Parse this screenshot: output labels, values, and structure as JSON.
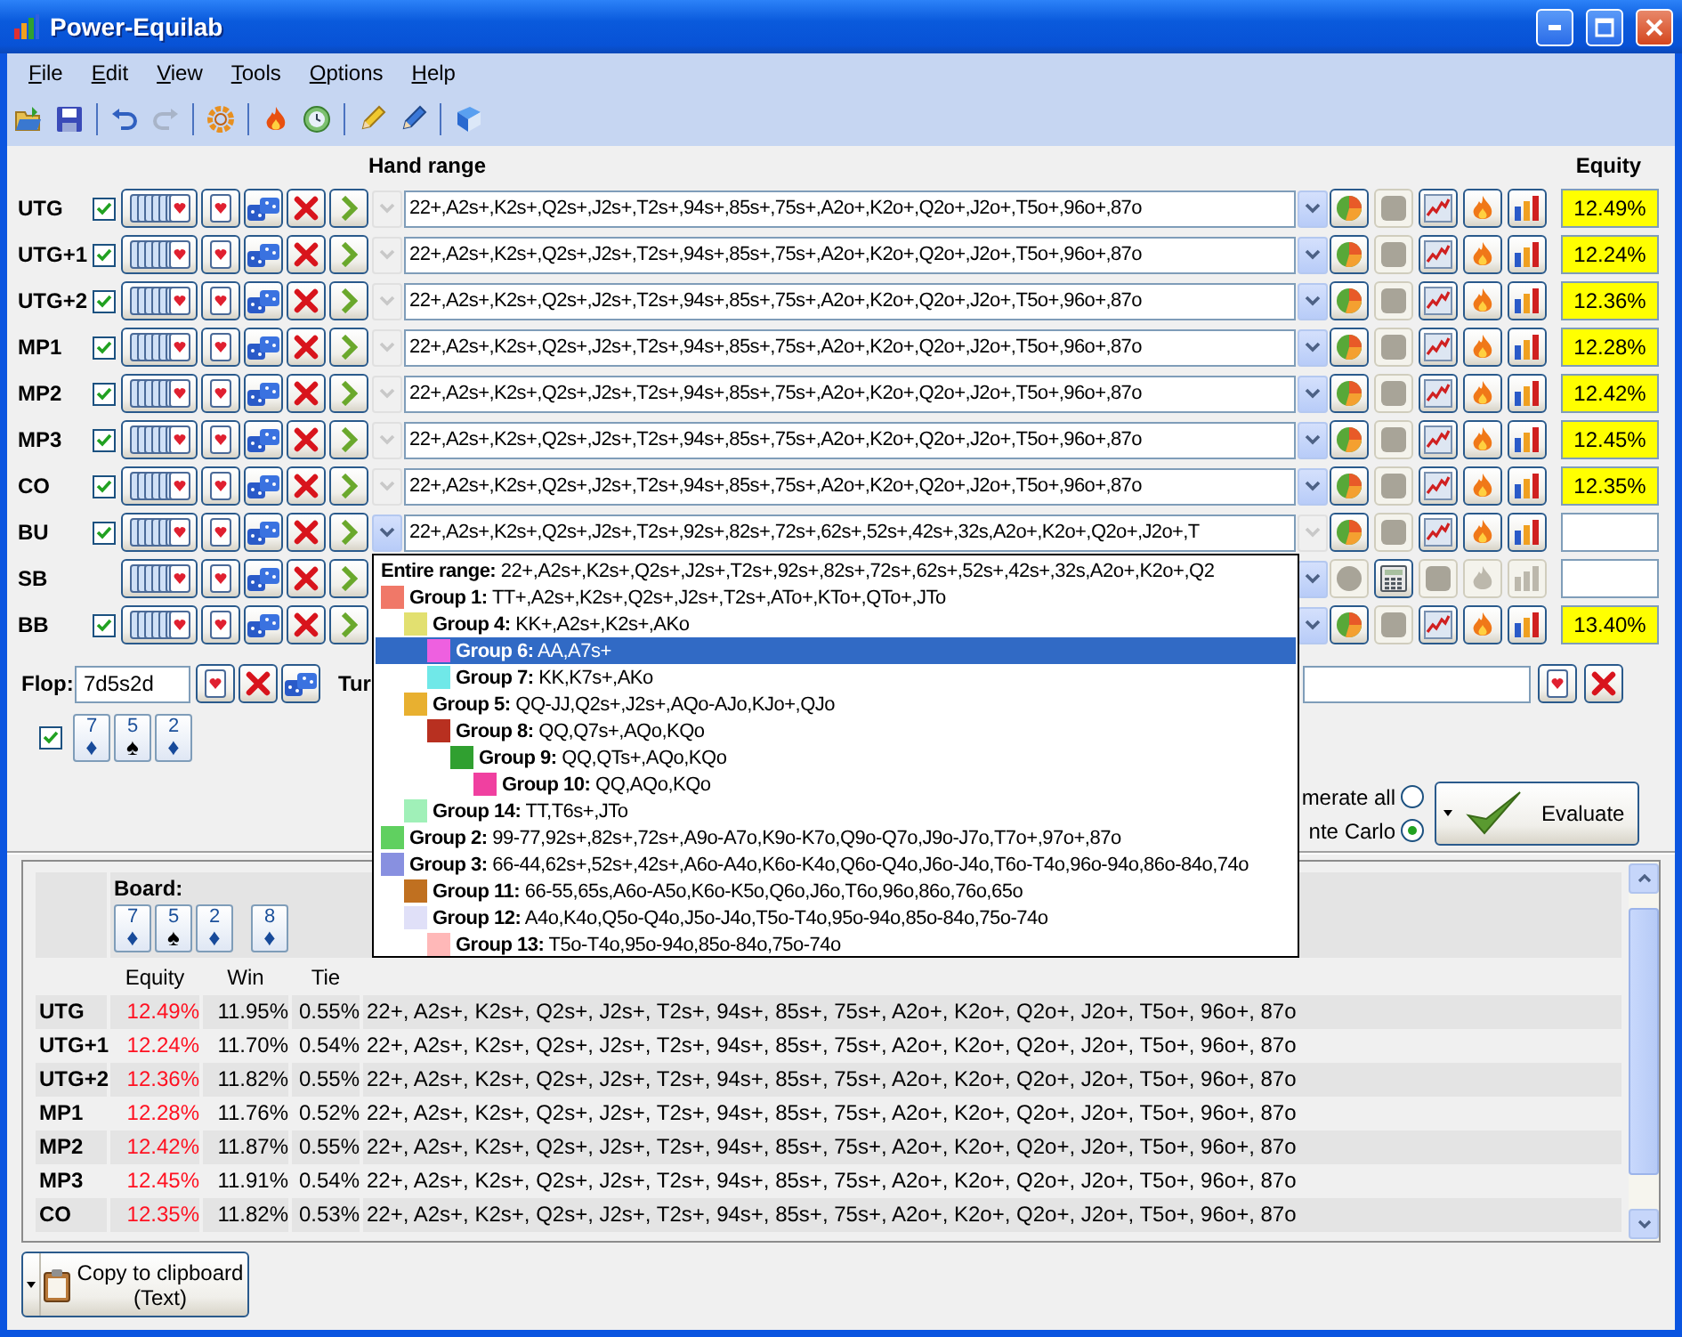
{
  "window": {
    "title": "Power-Equilab"
  },
  "menu": [
    "File",
    "Edit",
    "View",
    "Tools",
    "Options",
    "Help"
  ],
  "toolbar": {
    "redo_disabled": true
  },
  "headers": {
    "range": "Hand range",
    "equity": "Equity"
  },
  "players": [
    {
      "name": "UTG",
      "checked": true,
      "kind": "range",
      "editing": false,
      "range": "22+,A2s+,K2s+,Q2s+,J2s+,T2s+,94s+,85s+,75s+,A2o+,K2o+,Q2o+,J2o+,T5o+,96o+,87o",
      "equity": "12.49%"
    },
    {
      "name": "UTG+1",
      "checked": true,
      "kind": "range",
      "editing": false,
      "range": "22+,A2s+,K2s+,Q2s+,J2s+,T2s+,94s+,85s+,75s+,A2o+,K2o+,Q2o+,J2o+,T5o+,96o+,87o",
      "equity": "12.24%"
    },
    {
      "name": "UTG+2",
      "checked": true,
      "kind": "range",
      "editing": false,
      "range": "22+,A2s+,K2s+,Q2s+,J2s+,T2s+,94s+,85s+,75s+,A2o+,K2o+,Q2o+,J2o+,T5o+,96o+,87o",
      "equity": "12.36%"
    },
    {
      "name": "MP1",
      "checked": true,
      "kind": "range",
      "editing": false,
      "range": "22+,A2s+,K2s+,Q2s+,J2s+,T2s+,94s+,85s+,75s+,A2o+,K2o+,Q2o+,J2o+,T5o+,96o+,87o",
      "equity": "12.28%"
    },
    {
      "name": "MP2",
      "checked": true,
      "kind": "range",
      "editing": false,
      "range": "22+,A2s+,K2s+,Q2s+,J2s+,T2s+,94s+,85s+,75s+,A2o+,K2o+,Q2o+,J2o+,T5o+,96o+,87o",
      "equity": "12.42%"
    },
    {
      "name": "MP3",
      "checked": true,
      "kind": "range",
      "editing": false,
      "range": "22+,A2s+,K2s+,Q2s+,J2s+,T2s+,94s+,85s+,75s+,A2o+,K2o+,Q2o+,J2o+,T5o+,96o+,87o",
      "equity": "12.45%"
    },
    {
      "name": "CO",
      "checked": true,
      "kind": "range",
      "editing": false,
      "range": "22+,A2s+,K2s+,Q2s+,J2s+,T2s+,94s+,85s+,75s+,A2o+,K2o+,Q2o+,J2o+,T5o+,96o+,87o",
      "equity": "12.35%"
    },
    {
      "name": "BU",
      "checked": true,
      "kind": "range",
      "editing": true,
      "range": "22+,A2s+,K2s+,Q2s+,J2s+,T2s+,92s+,82s+,72s+,62s+,52s+,42s+,32s,A2o+,K2o+,Q2o+,J2o+,T"
    },
    {
      "name": "SB",
      "kind": "calculator",
      "editing": false
    },
    {
      "name": "BB",
      "checked": true,
      "kind": "range",
      "editing": false,
      "equity": "13.40%"
    }
  ],
  "flop": {
    "label": "Flop:",
    "value": "7d5s2d",
    "checked": true,
    "cards": [
      {
        "rank": "7",
        "suit": "♦",
        "color": "#174a9a"
      },
      {
        "rank": "5",
        "suit": "♠",
        "color": "#000000"
      },
      {
        "rank": "2",
        "suit": "♦",
        "color": "#174a9a"
      }
    ]
  },
  "turn": {
    "label": "Tur"
  },
  "evaluate": {
    "options": [
      {
        "label": "merate all",
        "selected": false
      },
      {
        "label": "nte Carlo",
        "selected": true
      }
    ],
    "button": "Evaluate"
  },
  "popup": {
    "header": "**Entire range:** 22+,A2s+,K2s+,Q2s+,J2s+,T2s+,92s+,82s+,72s+,62s+,52s+,42s+,32s,A2o+,K2o+,Q2",
    "groups": [
      {
        "label": "**Group 1:** TT+,A2s+,K2s+,Q2s+,J2s+,T2s+,ATo+,KTo+,QTo+,JTo",
        "color": "#f07868",
        "selected": false,
        "children": [
          {
            "label": "**Group 4:** KK+,A2s+,K2s+,AKo",
            "color": "#e2e070",
            "selected": false,
            "children": [
              {
                "label": "**Group 6:** AA,A7s+",
                "color": "#ee60e0",
                "selected": true
              },
              {
                "label": "**Group 7:** KK,K7s+,AKo",
                "color": "#70e8e8",
                "selected": false
              }
            ]
          },
          {
            "label": "**Group 5:** QQ-JJ,Q2s+,J2s+,AQo-AJo,KJo+,QJo",
            "color": "#e8b030",
            "selected": false,
            "children": [
              {
                "label": "**Group 8:** QQ,Q7s+,AQo,KQo",
                "color": "#b83020",
                "selected": false,
                "children": [
                  {
                    "label": "**Group 9:** QQ,QTs+,AQo,KQo",
                    "color": "#30a030",
                    "selected": false,
                    "children": [
                      {
                        "label": "**Group 10:** QQ,AQo,KQo",
                        "color": "#f040a0",
                        "selected": false
                      }
                    ]
                  }
                ]
              }
            ]
          },
          {
            "label": "**Group 14:** TT,T6s+,JTo",
            "color": "#a0f0b8",
            "selected": false
          }
        ]
      },
      {
        "label": "**Group 2:** 99-77,92s+,82s+,72s+,A9o-A7o,K9o-K7o,Q9o-Q7o,J9o-J7o,T7o+,97o+,87o",
        "color": "#60d060",
        "selected": false
      },
      {
        "label": "**Group 3:** 66-44,62s+,52s+,42s+,A6o-A4o,K6o-K4o,Q6o-Q4o,J6o-J4o,T6o-T4o,96o-94o,86o-84o,74o",
        "color": "#8890e0",
        "selected": false,
        "children": [
          {
            "label": "**Group 11:** 66-55,65s,A6o-A5o,K6o-K5o,Q6o,J6o,T6o,96o,86o,76o,65o",
            "color": "#c07020",
            "selected": false
          },
          {
            "label": "**Group 12:** A4o,K4o,Q5o-Q4o,J5o-J4o,T5o-T4o,95o-94o,85o-84o,75o-74o",
            "color": "#e0e0f8",
            "selected": false,
            "children": [
              {
                "label": "**Group 13:** T5o-T4o,95o-94o,85o-84o,75o-74o",
                "color": "#ffb8b8",
                "selected": false
              }
            ]
          }
        ]
      }
    ]
  },
  "results": {
    "board_label": "Board:",
    "board": [
      {
        "rank": "7",
        "suit": "♦",
        "color": "#174a9a"
      },
      {
        "rank": "5",
        "suit": "♠",
        "color": "#000000"
      },
      {
        "rank": "2",
        "suit": "♦",
        "color": "#174a9a"
      },
      {
        "rank": "8",
        "suit": "♦",
        "color": "#174a9a"
      }
    ],
    "columns": [
      "Equity",
      "Win",
      "Tie"
    ],
    "rows": [
      {
        "name": "UTG",
        "equity": "12.49%",
        "win": "11.95%",
        "tie": "0.55%",
        "range": "22+, A2s+, K2s+, Q2s+, J2s+, T2s+, 94s+, 85s+, 75s+, A2o+, K2o+, Q2o+, J2o+, T5o+, 96o+, 87o"
      },
      {
        "name": "UTG+1",
        "equity": "12.24%",
        "win": "11.70%",
        "tie": "0.54%",
        "range": "22+, A2s+, K2s+, Q2s+, J2s+, T2s+, 94s+, 85s+, 75s+, A2o+, K2o+, Q2o+, J2o+, T5o+, 96o+, 87o"
      },
      {
        "name": "UTG+2",
        "equity": "12.36%",
        "win": "11.82%",
        "tie": "0.55%",
        "range": "22+, A2s+, K2s+, Q2s+, J2s+, T2s+, 94s+, 85s+, 75s+, A2o+, K2o+, Q2o+, J2o+, T5o+, 96o+, 87o"
      },
      {
        "name": "MP1",
        "equity": "12.28%",
        "win": "11.76%",
        "tie": "0.52%",
        "range": "22+, A2s+, K2s+, Q2s+, J2s+, T2s+, 94s+, 85s+, 75s+, A2o+, K2o+, Q2o+, J2o+, T5o+, 96o+, 87o"
      },
      {
        "name": "MP2",
        "equity": "12.42%",
        "win": "11.87%",
        "tie": "0.55%",
        "range": "22+, A2s+, K2s+, Q2s+, J2s+, T2s+, 94s+, 85s+, 75s+, A2o+, K2o+, Q2o+, J2o+, T5o+, 96o+, 87o"
      },
      {
        "name": "MP3",
        "equity": "12.45%",
        "win": "11.91%",
        "tie": "0.54%",
        "range": "22+, A2s+, K2s+, Q2s+, J2s+, T2s+, 94s+, 85s+, 75s+, A2o+, K2o+, Q2o+, J2o+, T5o+, 96o+, 87o"
      },
      {
        "name": "CO",
        "equity": "12.35%",
        "win": "11.82%",
        "tie": "0.53%",
        "range": "22+, A2s+, K2s+, Q2s+, J2s+, T2s+, 94s+, 85s+, 75s+, A2o+, K2o+, Q2o+, J2o+, T5o+, 96o+, 87o"
      }
    ]
  },
  "copy_button": {
    "lines": [
      "Copy to clipboard",
      "(Text)"
    ]
  }
}
